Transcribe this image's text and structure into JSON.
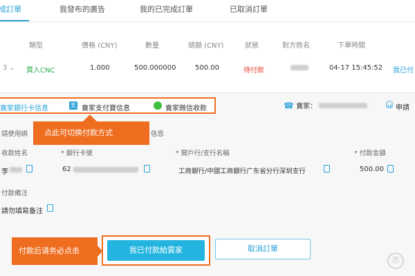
{
  "tabs": [
    {
      "label": "成訂單",
      "active": true
    },
    {
      "label": "我發布的廣告",
      "active": false
    },
    {
      "label": "我的已完成訂單",
      "active": false
    },
    {
      "label": "已取消訂單",
      "active": false
    }
  ],
  "table": {
    "headers": [
      "類型",
      "價格 (CNY)",
      "數量",
      "總額 (CNY)",
      "狀態",
      "對方姓名",
      "下單時間"
    ],
    "row": {
      "type": "買入CNC",
      "price": "1.000",
      "amount": "500.000000",
      "total": "500.00",
      "status": "待付款",
      "time": "04-17 15:45:52",
      "action": "我已付"
    }
  },
  "payment_tabs": [
    {
      "label": "賣家銀行卡信息",
      "active": true,
      "icon": "bank-icon"
    },
    {
      "label": "賣家支付寶信息",
      "active": false,
      "icon": "alipay-icon"
    },
    {
      "label": "賣家微信收款",
      "active": false,
      "icon": "wechat-icon"
    }
  ],
  "seller": {
    "label": "賣家：",
    "appeal": "申請"
  },
  "callouts": {
    "switch_payment": "点此可切换付款方式",
    "confirm_after_pay": "付款后请务必点击"
  },
  "bank_info": {
    "hint_left": "請使用綁",
    "hint_right": "信息",
    "fields": {
      "name_label": "收款姓名",
      "name_value": "李",
      "card_label": "* 銀行卡號",
      "card_value": "62",
      "bank_label": "* 開戶行/支行名稱",
      "bank_value": "工商銀行/中國工商銀行广东省分行深圳支行",
      "amount_label": "* 付款金額",
      "amount_value": "500.00"
    },
    "note_label": "付款備注",
    "note_value": "請勿填寫备注"
  },
  "buttons": {
    "confirm": "我已付款給賣家",
    "cancel": "取消訂單"
  },
  "watermark": "币",
  "colors": {
    "accent": "#2aa3d8",
    "callout": "#ee6d1f",
    "confirm_button": "#23b5e0",
    "buy_green": "#2aa84a",
    "pending_red": "#e8453c"
  }
}
